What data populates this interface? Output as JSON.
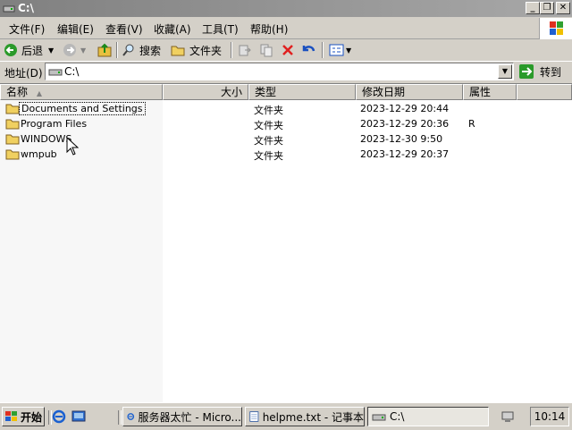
{
  "window": {
    "title": "C:\\"
  },
  "menu": [
    {
      "label": "文件(F)"
    },
    {
      "label": "编辑(E)"
    },
    {
      "label": "查看(V)"
    },
    {
      "label": "收藏(A)"
    },
    {
      "label": "工具(T)"
    },
    {
      "label": "帮助(H)"
    }
  ],
  "toolbar": {
    "back_label": "后退",
    "search_label": "搜索",
    "folders_label": "文件夹"
  },
  "address": {
    "label": "地址(D)",
    "value": "C:\\",
    "go_label": "转到"
  },
  "columns": {
    "name": "名称",
    "size": "大小",
    "type": "类型",
    "modified": "修改日期",
    "attributes": "属性"
  },
  "files": [
    {
      "name": "Documents and Settings",
      "type": "文件夹",
      "modified": "2023-12-29 20:44",
      "attributes": ""
    },
    {
      "name": "Program Files",
      "type": "文件夹",
      "modified": "2023-12-29 20:36",
      "attributes": "R"
    },
    {
      "name": "WINDOWS",
      "type": "文件夹",
      "modified": "2023-12-30 9:50",
      "attributes": ""
    },
    {
      "name": "wmpub",
      "type": "文件夹",
      "modified": "2023-12-29 20:37",
      "attributes": ""
    }
  ],
  "taskbar": {
    "start_label": "开始",
    "tasks": [
      {
        "label": "服务器太忙 - Micro..."
      },
      {
        "label": "helpme.txt - 记事本"
      },
      {
        "label": "C:\\"
      }
    ],
    "clock": "10:14"
  },
  "colors": {
    "title_bg": "#a0a0a0",
    "face": "#d4d0c8",
    "selection_dotted": "#000000"
  }
}
